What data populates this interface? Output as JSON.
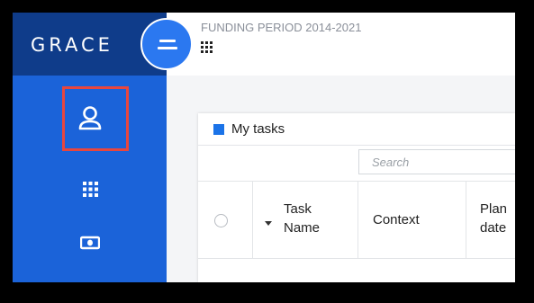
{
  "app": {
    "brand": "GRACE",
    "period": "FUNDING PERIOD 2014-2021"
  },
  "sidebar": {
    "icons": [
      "user-icon",
      "apps-grid-icon",
      "money-icon"
    ]
  },
  "card": {
    "title": "My tasks",
    "search_placeholder": "Search",
    "columns": {
      "task_name_line1": "Task",
      "task_name_line2": "Name",
      "context": "Context",
      "planned_line1": "Plan",
      "planned_line2": "date"
    }
  },
  "colors": {
    "sidebar": "#1b63d9",
    "brand_bg": "#0f3c8a",
    "highlight": "#e8463e",
    "accent": "#1b73e8"
  }
}
